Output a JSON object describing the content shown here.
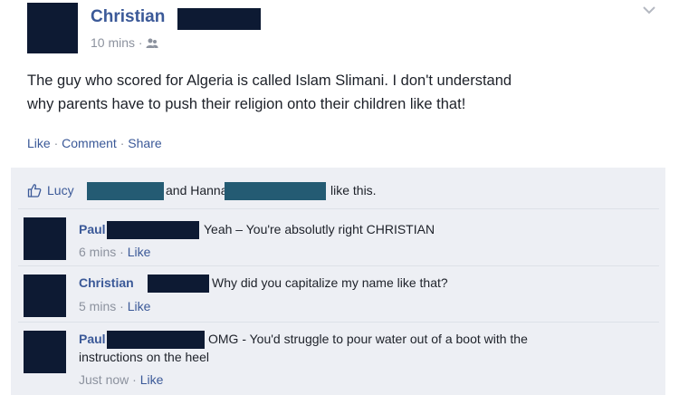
{
  "post": {
    "author_name": "Christian",
    "timestamp": "10 mins",
    "audience_icon": "friends-icon",
    "body_line1": "The guy who scored for Algeria is called Islam Slimani. I don't understand",
    "body_line2": "why parents have to push their religion onto their children like that!",
    "actions": {
      "like": "Like",
      "comment": "Comment",
      "share": "Share",
      "sep": " · "
    }
  },
  "likes": {
    "icon": "thumbs-up-icon",
    "person1": "Lucy",
    "joiner": "and Hanna",
    "suffix": "like this."
  },
  "comments": [
    {
      "author": "Paul",
      "text": "Yeah – You're absolutly right CHRISTIAN",
      "time": "6 mins",
      "like": "Like"
    },
    {
      "author": "Christian",
      "text": "Why did you capitalize my name like that?",
      "time": "5 mins",
      "like": "Like"
    },
    {
      "author": "Paul",
      "text_line1": "OMG - You'd struggle to pour water out of a boot with the",
      "text_line2": "instructions on the heel",
      "time": "Just now",
      "like": "Like"
    }
  ],
  "colors": {
    "link": "#3b5998",
    "redaction": "#0d1a33",
    "redaction_teal": "#245b73",
    "bar_bg": "#edeff4"
  }
}
